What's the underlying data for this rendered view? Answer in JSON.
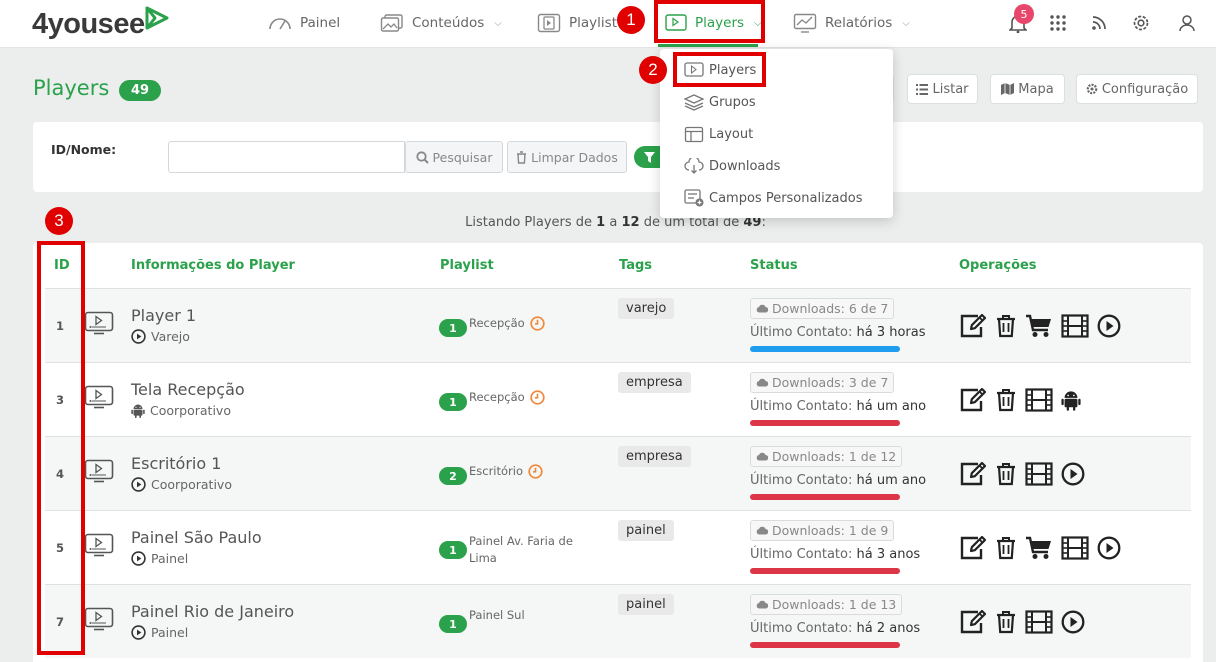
{
  "brand": {
    "logo_text": "4yousee",
    "accent": "#2aa14a"
  },
  "nav": {
    "items": [
      {
        "label": "Painel",
        "icon": "gauge-icon",
        "has_chevron": false
      },
      {
        "label": "Conteúdos",
        "icon": "images-icon",
        "has_chevron": true
      },
      {
        "label": "Playlist",
        "icon": "playlist-icon",
        "has_chevron": false
      },
      {
        "label": "Players",
        "icon": "player-icon",
        "has_chevron": true,
        "active": true
      },
      {
        "label": "Relatórios",
        "icon": "reports-icon",
        "has_chevron": true
      }
    ],
    "notifications_count": "5",
    "right_icons": [
      "bell-icon",
      "apps-grid-icon",
      "rss-icon",
      "gear-icon",
      "user-icon"
    ]
  },
  "dropdown": {
    "items": [
      {
        "label": "Players",
        "icon": "player-icon"
      },
      {
        "label": "Grupos",
        "icon": "layers-icon"
      },
      {
        "label": "Layout",
        "icon": "layout-icon"
      },
      {
        "label": "Downloads",
        "icon": "cloud-download-icon"
      },
      {
        "label": "Campos Personalizados",
        "icon": "custom-fields-icon"
      }
    ]
  },
  "page": {
    "title": "Players",
    "count": "49",
    "header_buttons": [
      {
        "label": "Listar",
        "icon": "list-icon"
      },
      {
        "label": "Mapa",
        "icon": "map-icon"
      },
      {
        "label": "Configuração",
        "icon": "gear-icon"
      }
    ]
  },
  "filter": {
    "label": "ID/Nome:",
    "input_value": "",
    "search_label": "Pesquisar",
    "clear_label": "Limpar Dados"
  },
  "listing": {
    "prefix": "Listando Players de",
    "from": "1",
    "mid1": "a",
    "to": "12",
    "mid2": "de um total de",
    "total": "49",
    "suffix": ":"
  },
  "table": {
    "headers": [
      "ID",
      "Informações do Player",
      "Playlist",
      "Tags",
      "Status",
      "Operações"
    ],
    "rows": [
      {
        "id": "1",
        "name": "Player 1",
        "group": "Varejo",
        "group_icon": "play-circle-icon",
        "playlist_count": "1",
        "playlist": "Recepção",
        "playlist_clock": true,
        "tag": "varejo",
        "downloads": "Downloads: 6 de 7",
        "contact_label": "Último Contato:",
        "contact_value": "há 3 horas",
        "status_color": "#1e9cee",
        "ops": [
          "edit-icon",
          "trash-icon",
          "cart-icon",
          "film-icon",
          "play-circle-icon"
        ]
      },
      {
        "id": "3",
        "name": "Tela Recepção",
        "group": "Coorporativo",
        "group_icon": "android-icon",
        "playlist_count": "1",
        "playlist": "Recepção",
        "playlist_clock": true,
        "tag": "empresa",
        "downloads": "Downloads: 3 de 7",
        "contact_label": "Último Contato:",
        "contact_value": "há um ano",
        "status_color": "#dc3545",
        "ops": [
          "edit-icon",
          "trash-icon",
          "film-icon",
          "android-icon"
        ]
      },
      {
        "id": "4",
        "name": "Escritório 1",
        "group": "Coorporativo",
        "group_icon": "play-circle-icon",
        "playlist_count": "2",
        "playlist": "Escritório",
        "playlist_clock": true,
        "tag": "empresa",
        "downloads": "Downloads: 1 de 12",
        "contact_label": "Último Contato:",
        "contact_value": "há um ano",
        "status_color": "#dc3545",
        "ops": [
          "edit-icon",
          "trash-icon",
          "film-icon",
          "play-circle-icon"
        ]
      },
      {
        "id": "5",
        "name": "Painel São Paulo",
        "group": "Painel",
        "group_icon": "play-circle-icon",
        "playlist_count": "1",
        "playlist": "Painel Av. Faria de Lima",
        "playlist_clock": false,
        "tag": "painel",
        "downloads": "Downloads: 1 de 9",
        "contact_label": "Último Contato:",
        "contact_value": "há 3 anos",
        "status_color": "#dc3545",
        "ops": [
          "edit-icon",
          "trash-icon",
          "cart-icon",
          "film-icon",
          "play-circle-icon"
        ]
      },
      {
        "id": "7",
        "name": "Painel Rio de Janeiro",
        "group": "Painel",
        "group_icon": "play-circle-icon",
        "playlist_count": "1",
        "playlist": "Painel Sul",
        "playlist_clock": false,
        "tag": "painel",
        "downloads": "Downloads: 1 de 13",
        "contact_label": "Último Contato:",
        "contact_value": "há 2 anos",
        "status_color": "#dc3545",
        "ops": [
          "edit-icon",
          "trash-icon",
          "film-icon",
          "play-circle-icon"
        ]
      }
    ]
  },
  "annotations": {
    "markers": [
      "1",
      "2",
      "3"
    ],
    "color": "#e00000"
  }
}
